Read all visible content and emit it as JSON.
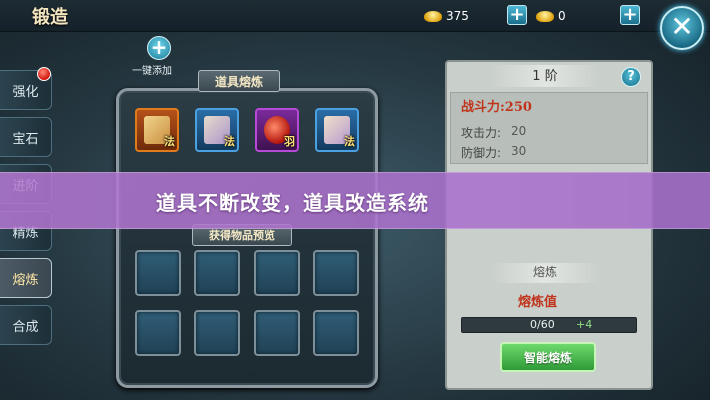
{
  "header": {
    "title": "锻造",
    "gold": "375",
    "ingot": "0"
  },
  "sidebar": {
    "items": [
      {
        "label": "强化"
      },
      {
        "label": "宝石"
      },
      {
        "label": "进阶"
      },
      {
        "label": "精炼"
      },
      {
        "label": "熔炼"
      },
      {
        "label": "合成"
      }
    ],
    "active": "熔炼"
  },
  "add_all": {
    "label": "一键添加"
  },
  "item_panel": {
    "title": "道具熔炼",
    "items": [
      {
        "icon": "scroll-icon",
        "tag": "法",
        "border": "#e07a1a"
      },
      {
        "icon": "scroll-icon",
        "tag": "法",
        "border": "#4aa0e0"
      },
      {
        "icon": "potion-icon",
        "tag": "羽",
        "border": "#b44ad6"
      },
      {
        "icon": "scroll-icon",
        "tag": "法",
        "border": "#4aa0e0"
      }
    ],
    "preview_title": "获得物品预览"
  },
  "refine_panel": {
    "rank": "1 阶",
    "combat_power": "战斗力:250",
    "stats": [
      {
        "label": "攻击力:",
        "value": "20"
      },
      {
        "label": "防御力:",
        "value": "30"
      }
    ],
    "section_title": "熔炼",
    "value_label": "熔炼值",
    "progress_text": "0/60",
    "progress_fraction": 0,
    "bonus": "+4",
    "smart_button": "智能熔炼"
  },
  "overlay": {
    "text": "道具不断改变，道具改造系统"
  }
}
